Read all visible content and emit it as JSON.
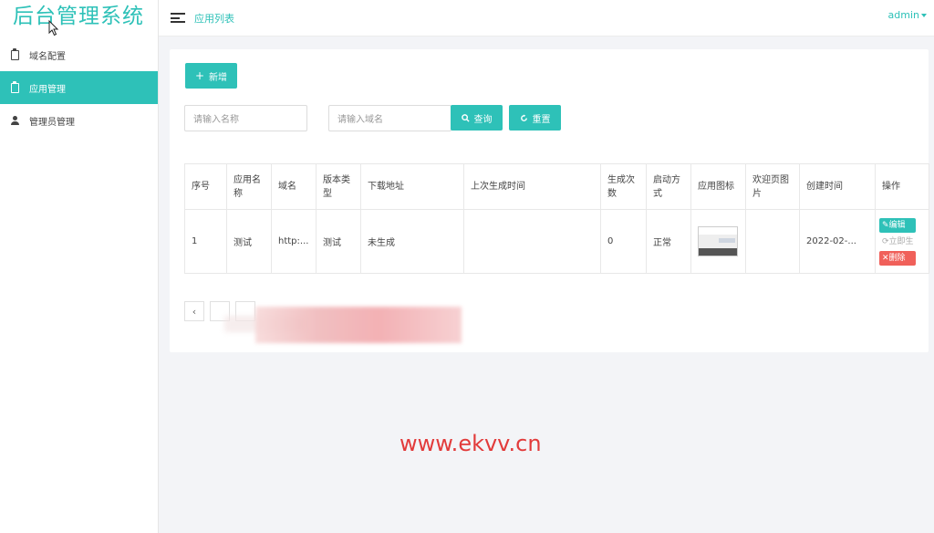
{
  "app": {
    "title": "后台管理系统"
  },
  "sidebar": {
    "items": [
      {
        "label": "域名配置",
        "icon": "clipboard-icon",
        "active": false
      },
      {
        "label": "应用管理",
        "icon": "clipboard-icon",
        "active": true
      },
      {
        "label": "管理员管理",
        "icon": "user-icon",
        "active": false
      }
    ]
  },
  "header": {
    "breadcrumb": "应用列表",
    "user": "admin"
  },
  "toolbar": {
    "add_label": "新增",
    "name_placeholder": "请输入名称",
    "domain_placeholder": "请输入域名",
    "search_label": "查询",
    "reset_label": "重置"
  },
  "table": {
    "headers": [
      "序号",
      "应用名称",
      "域名",
      "版本类型",
      "下载地址",
      "上次生成时间",
      "生成次数",
      "启动方式",
      "应用图标",
      "欢迎页图片",
      "创建时间",
      "操作"
    ],
    "rows": [
      {
        "index": "1",
        "name": "测试",
        "domain": "http:...",
        "version_type": "测试",
        "download_url": "未生成",
        "last_generated": "",
        "generate_count": "0",
        "launch_mode": "正常",
        "welcome_image": "",
        "created_at": "2022-02-...",
        "actions": {
          "edit": "编辑",
          "generate": "立即生",
          "delete": "删除"
        }
      }
    ]
  },
  "pagination": {
    "prev": "‹"
  },
  "watermark": "www.ekvv.cn",
  "colors": {
    "accent": "#2ec1b8",
    "danger": "#f0605a"
  }
}
